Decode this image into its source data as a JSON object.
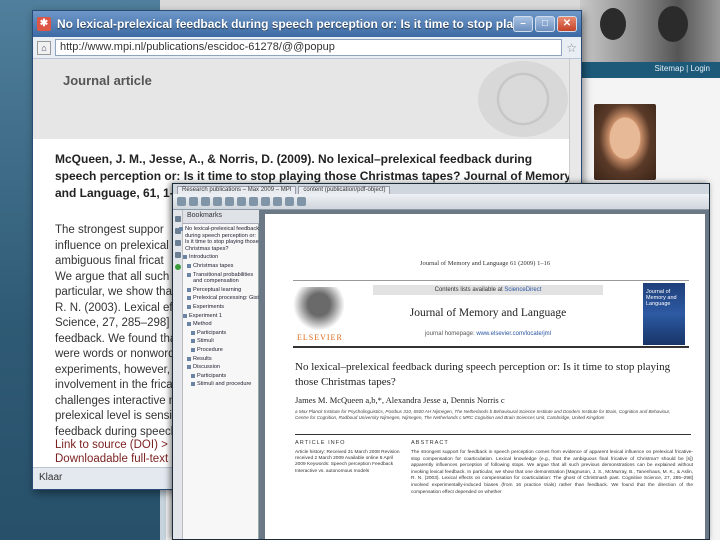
{
  "background_site": {
    "sitemap_links": "Sitemap | Login"
  },
  "browser": {
    "title": "No lexical-prelexical feedback during speech perception or: Is it time to stop playing th...",
    "url": "http://www.mpi.nl/publications/escidoc-61278/@@popup",
    "status": "Klaar",
    "section_label": "Journal article",
    "citation": "McQueen, J. M., Jesse, A., & Norris, D. (2009). No lexical–prelexical feedback during speech perception or: Is it time to stop playing those Christmas tapes? Journal of Memory and Language, 61, 1-16.",
    "abstract_lines": [
      "The strongest suppor",
      "influence on prelexical",
      "ambiguous final fricat",
      "We argue that all such",
      "particular, we show that",
      "R. N. (2003). Lexical eff",
      "Science, 27, 285–298]",
      "feedback. We found tha",
      "were words or nonwords",
      "experiments, however, th",
      "involvement in the fricat",
      "challenges interactive m",
      "prelexical level is sensit",
      "feedback during speech"
    ],
    "links": [
      "Link to source (DOI) >",
      "Downloadable full-text >"
    ]
  },
  "pdf_reader": {
    "tabs": [
      "Research publications – Max 2009 – MPI",
      "content (publication/pdf-object)"
    ],
    "sidebar_header": "Bookmarks",
    "outline": [
      "No lexical-prelexical feedback during speech perception or: Is it time to stop playing those Christmas tapes?",
      "Introduction",
      "Christmas tapes",
      "Transitional probabilities and compensation",
      "Perceptual learning",
      "Prelexical processing: Gist",
      "Experiments",
      "Method",
      "Participants",
      "Stimuli",
      "Procedure",
      "Results",
      "Discussion",
      "Experiment 1",
      "Participants",
      "Stimuli and procedure"
    ],
    "page": {
      "journal_ref": "Journal of Memory and Language 61 (2009) 1–16",
      "contents_prefix": "Contents lists available at ",
      "contents_link": "ScienceDirect",
      "journal_name": "Journal of Memory and Language",
      "homepage_prefix": "journal homepage: ",
      "homepage_link": "www.elsevier.com/locate/jml",
      "publisher": "ELSEVIER",
      "cover_title": "Journal of Memory and Language",
      "title": "No lexical–prelexical feedback during speech perception or: Is it time to stop playing those Christmas tapes?",
      "authors": "James M. McQueen a,b,*, Alexandra Jesse a, Dennis Norris c",
      "affiliations": "a Max Planck Institute for Psycholinguistics, Postbus 310, 6500 AH Nijmegen, The Netherlands  b Behavioural Science Institute and Donders Institute for Brain, Cognition and Behaviour, Centre for Cognition, Radboud University Nijmegen, Nijmegen, The Netherlands  c MRC Cognition and Brain Sciences Unit, Cambridge, United Kingdom",
      "article_info_heading": "ARTICLE INFO",
      "abstract_heading": "ABSTRACT",
      "article_info": "Article history: Received 31 March 2008 Revision received 2 March 2009 Available online 8 April 2009 Keywords: Speech perception Feedback Interactive vs. autonomous models",
      "abstract": "The strongest support for feedback in speech perception comes from evidence of apparent lexical influence on prelexical fricative-stop compensation for coarticulation. Lexical knowledge (e.g., that the ambiguous final fricative of Christma? should be [s]) apparently influences perception of following stops. We argue that all such previous demonstrations can be explained without invoking lexical feedback. In particular, we show that one demonstration [Magnuson, J. S., McMurray, B., Tanenhaus, M. K., & Aslin, R. N. (2003). Lexical effects on compensation for coarticulation: The ghost of Christmash past. Cognitive Science, 27, 285–298] involved experimentally-induced biases (from 16 practice trials) rather than feedback. We found that the direction of the compensation effect depended on whether"
    }
  },
  "colors": {
    "titlebar": "#3c6aa4",
    "citation_text": "#222222",
    "link": "#7a1f1f",
    "elsevier": "#e06a1a"
  }
}
